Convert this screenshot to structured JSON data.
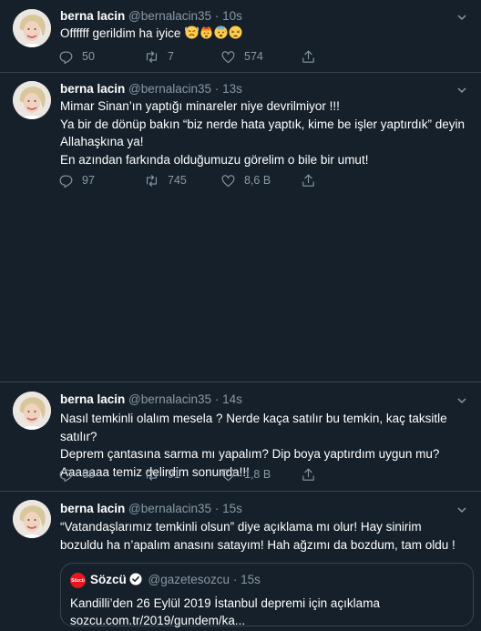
{
  "tweets": [
    {
      "name": "berna lacin",
      "handle": "@bernalacin35",
      "time": "10s",
      "lines": [
        "Offffff gerildim ha iyice"
      ],
      "emojis": [
        "frustrated-face-emoji",
        "exploding-head-emoji",
        "anxious-face-emoji",
        "tired-face-emoji"
      ],
      "replies": "50",
      "retweets": "7",
      "likes": "574"
    },
    {
      "name": "berna lacin",
      "handle": "@bernalacin35",
      "time": "13s",
      "lines": [
        "Mimar Sinan’ın yaptığı minareler niye devrilmiyor !!!",
        "Ya bir de dönüp bakın “biz nerde hata yaptık, kime be işler yaptırdık” deyin Allahaşkına ya!",
        "En azından farkında olduğumuzu görelim o bile bir umut!"
      ],
      "replies": "97",
      "retweets": "745",
      "likes": "8,6 B"
    },
    {
      "name": "berna lacin",
      "handle": "@bernalacin35",
      "time": "14s",
      "lines": [
        "Nasıl temkinli olalım mesela ? Nerde kaça satılır bu temkin, kaç taksitle satılır?",
        "Deprem çantasına sarma mı yapalım? Dip boya yaptırdım uygun mu?",
        "Aaaaaaa temiz delirdim sonunda!!!"
      ],
      "replies": "68",
      "retweets": "91",
      "likes": "1,8 B"
    },
    {
      "name": "berna lacin",
      "handle": "@bernalacin35",
      "time": "15s",
      "lines": [
        "“Vatandaşlarımız temkinli olsun” diye açıklama mı olur! Hay sinirim bozuldu ha n’apalım anasını satayım! Hah ağzımı da bozdum, tam oldu !"
      ],
      "quote": {
        "logo_text": "Sözcü",
        "name": "Sözcü",
        "handle": "@gazetesozcu",
        "time": "15s",
        "text": "Kandilli’den 26 Eylül 2019 İstanbul depremi için açıklama",
        "link": "sozcu.com.tr/2019/gundem/ka..."
      }
    }
  ],
  "separator": "·",
  "colors": {
    "background": "#15202b",
    "border": "#38444d",
    "secondary_text": "#8899a6",
    "brand_red": "#e5161e"
  }
}
